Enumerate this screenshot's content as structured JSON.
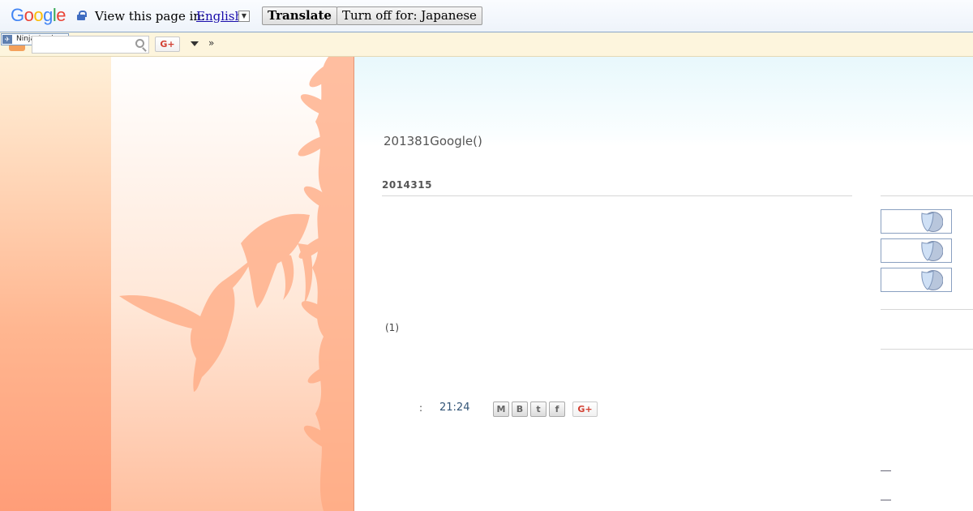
{
  "translate_bar": {
    "logo": {
      "g1": "G",
      "o1": "o",
      "o2": "o",
      "g2": "g",
      "l": "l",
      "e": "e"
    },
    "view_text": "View this page in:",
    "language": "English",
    "dropdown_glyph": "▼",
    "translate_label": "Translate",
    "turn_off_label": "Turn off for: Japanese"
  },
  "navbar": {
    "ninja_label": "Ninja Analyze",
    "search_value": "",
    "gplus_label": "G+",
    "more_label": "»"
  },
  "post": {
    "title": "201381Google()",
    "date": "2014315",
    "comments": "(1)",
    "colon": ":",
    "time": "21:24",
    "share_icons": [
      "email-icon",
      "blogger-icon",
      "twitter-icon",
      "facebook-icon"
    ],
    "share_glyphs": {
      "email": "M",
      "blogger": "B",
      "twitter": "t",
      "facebook": "f"
    },
    "gplus_label": "G+"
  },
  "sidebar": {
    "badges": [
      "shield-badge",
      "shield-badge",
      "shield-badge"
    ]
  },
  "colors": {
    "accent_orange": "#ff9d78",
    "link_blue": "#1a0dab",
    "time_color": "#335577"
  }
}
